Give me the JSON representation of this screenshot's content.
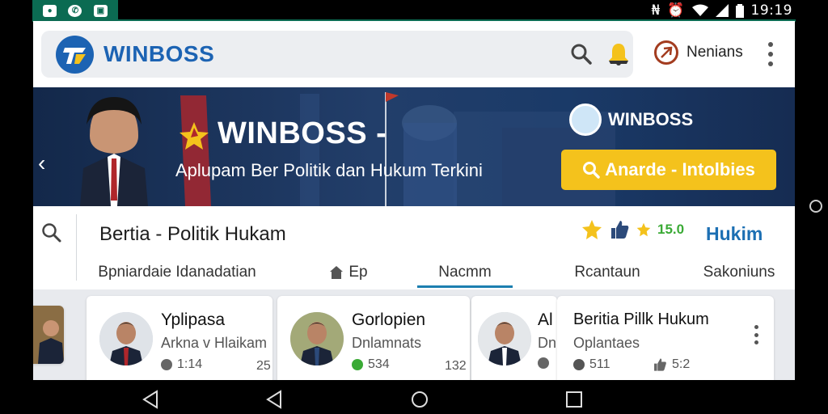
{
  "status_bar": {
    "time": "19:19",
    "left_icons": [
      "notification-icon",
      "whatsapp-icon",
      "message-icon"
    ],
    "right_icons": [
      "nfc-icon",
      "alarm-icon",
      "wifi-icon",
      "signal-icon",
      "battery-icon"
    ]
  },
  "header": {
    "logo_text": "WINBOSS",
    "login_label": "Nenians"
  },
  "banner": {
    "hero_title": "WINBOSS -",
    "subtitle": "Aplupam Ber Politik dan Hukum Terkini",
    "logo_text": "WINBOSS",
    "cta_label": "Anarde - Intolbies"
  },
  "section": {
    "title": "Bertia - Politik Hukam",
    "rating": "15.0",
    "link": "Hukim",
    "tabs": [
      {
        "label": "Bpniardaie Idanadatian"
      },
      {
        "label": "Ep"
      },
      {
        "label": "Nacmm"
      },
      {
        "label": "Rcantaun"
      },
      {
        "label": "Sakoniuns"
      }
    ]
  },
  "cards": [
    {
      "title": "Yplipasa",
      "subtitle": "Arkna v Hlaikam",
      "meta": "1:14",
      "count": "25"
    },
    {
      "title": "Gorlopien",
      "subtitle": "Dnlamnats",
      "meta": "534",
      "count": "132"
    },
    {
      "title": "Al",
      "subtitle": "Dn",
      "meta": ""
    },
    {
      "title": "Beritia Pillk Hukum",
      "subtitle": "Oplantaes",
      "meta": "511",
      "count": "5:2"
    }
  ],
  "colors": {
    "brand_blue": "#1c63b3",
    "status_green": "#0b6b52",
    "cta_yellow": "#f4c21c",
    "tab_underline": "#1c7fb0"
  }
}
